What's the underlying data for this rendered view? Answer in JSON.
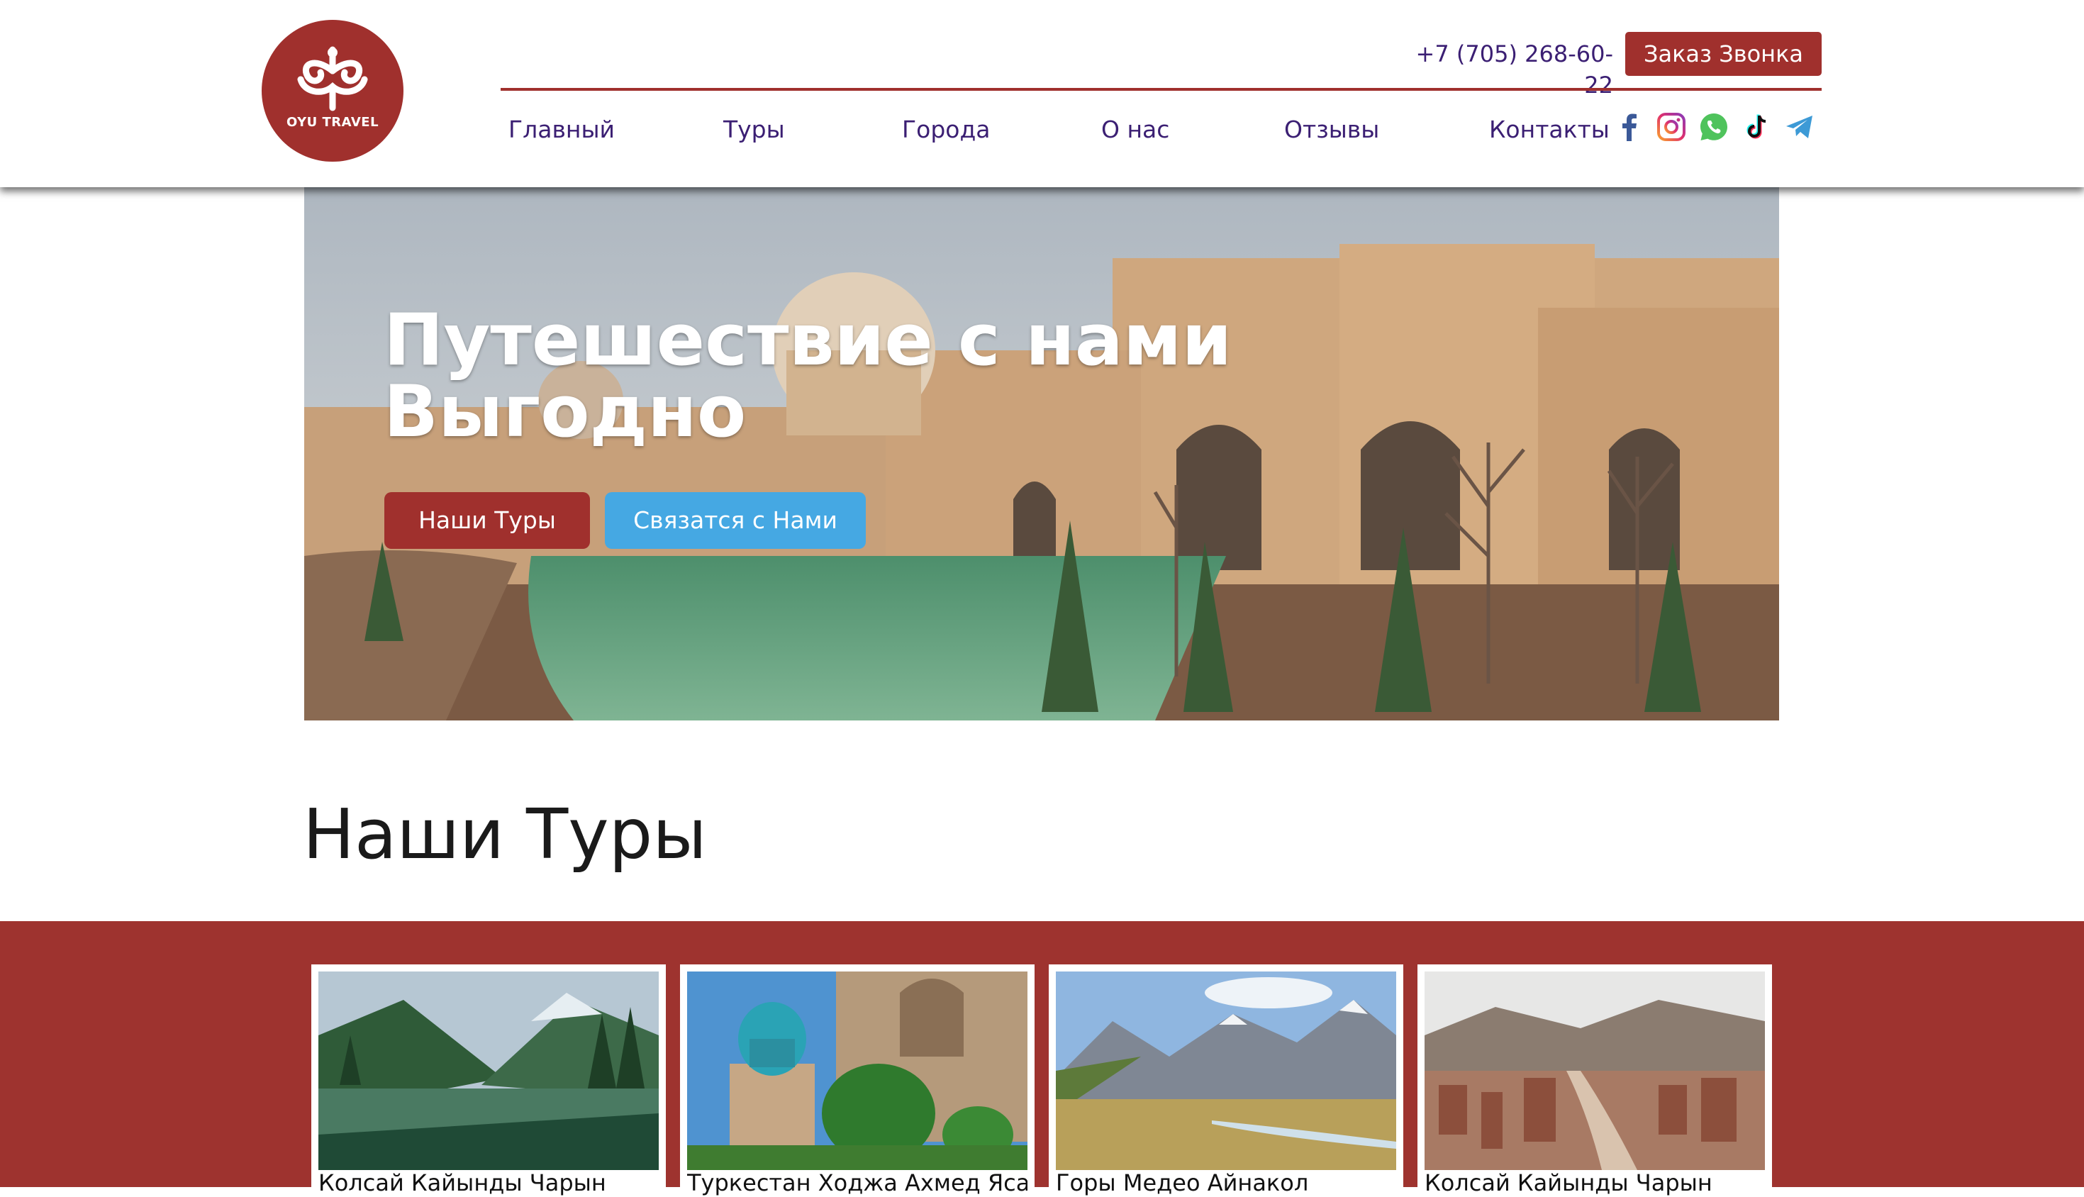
{
  "header": {
    "logo_text": "OYU TRAVEL",
    "phone": "+7 (705) 268-60-22",
    "callback_label": "Заказ Звонка",
    "nav": [
      "Главный",
      "Туры",
      "Города",
      "О нас",
      "Отзывы",
      "Контакты"
    ],
    "social_icons": [
      "facebook-icon",
      "instagram-icon",
      "whatsapp-icon",
      "tiktok-icon",
      "telegram-icon"
    ]
  },
  "hero": {
    "title_line1": "Путешествие с нами",
    "title_line2": "Выгодно",
    "tours_button": "Наши Туры",
    "contact_button": "Связатся с Нами"
  },
  "tours": {
    "section_title": "Наши Туры",
    "cards": [
      {
        "title": "Колсай Кайынды Чарын"
      },
      {
        "title": "Туркестан Ходжа Ахмед Ясави"
      },
      {
        "title": "Горы Медео Айнакол"
      },
      {
        "title": "Колсай Кайынды Чарын"
      }
    ]
  },
  "colors": {
    "brand_red": "#a0302d",
    "nav_text": "#3b1f73",
    "button_blue": "#45a8e3"
  }
}
